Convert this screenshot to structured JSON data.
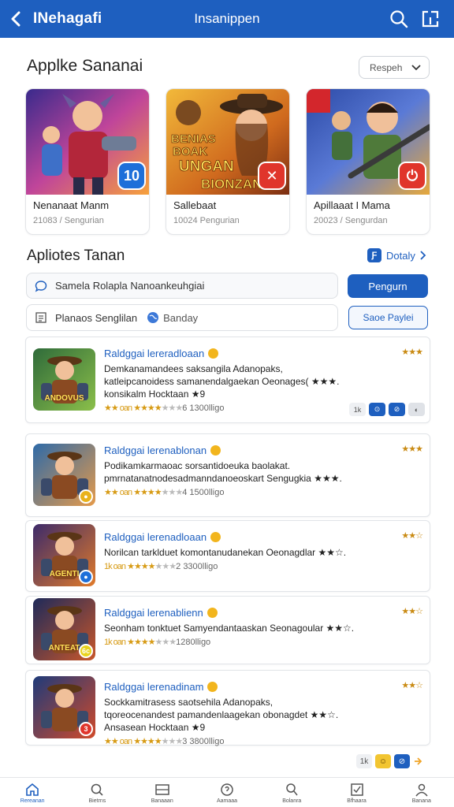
{
  "header": {
    "app_title": "INehagafi",
    "screen_title": "Insanippen",
    "icons": [
      "back-arrow-icon",
      "search-icon",
      "share-icon"
    ]
  },
  "section1": {
    "title": "Applke Sananai",
    "sort_label": "Respeh",
    "cards": [
      {
        "name": "Nenanaat Manm",
        "meta": "21083 / Sengurian",
        "badge": "10",
        "badge_color": "#1e6fd9"
      },
      {
        "name": "Sallebaat",
        "meta": "10024 Pengurian",
        "badge": "✕",
        "badge_color": "#e0352b",
        "art_text": [
          "BENIAS",
          "BOAK",
          "UNGAN",
          "BIONZAN"
        ]
      },
      {
        "name": "Apillaaat I Mama",
        "meta": "20023 / Sengurdan",
        "badge": "⏻",
        "badge_color": "#e0352b"
      }
    ]
  },
  "section2": {
    "title": "Apliotes Tanan",
    "see_all": "Dotaly",
    "see_all_icon": "Ƒ",
    "search_placeholder": "Samela Rolapla  Nanoankeuhgiai",
    "search_button": "Pengurn",
    "filter_label": "Planaos Senglilan",
    "filter_chip": "Banday",
    "filter_button": "Saoe Paylei"
  },
  "apps": [
    {
      "title": "Raldggai lereradloaan",
      "stars": "★★★",
      "desc1": "Demkanamandees saksangila Adanopaks,",
      "desc2": "katleipcanoidess samanendalgaekan Oeonages( ★★★.",
      "desc3": "konsikalm Hocktaan ★9",
      "meta_prefix": "★★ oan",
      "meta_stars": "★★★★",
      "meta_gray": "★★★",
      "meta_suffix": "6 1300lligo",
      "thumb_text": "ANDOVUS",
      "mini": "",
      "mini_color": "#1e6fd9"
    },
    {
      "title": "Raldggai lerenablonan",
      "stars": "★★★",
      "desc1": "Podikamkarmaoac sorsantidoeuka baolakat.",
      "desc2": "pmrnatanatnodesadmanndanoeoskart Sengugkia ★★★.",
      "desc3": "",
      "meta_prefix": "★★ oan",
      "meta_stars": "★★★★",
      "meta_gray": "★★★",
      "meta_suffix": "4 1500lligo",
      "thumb_text": "",
      "mini": "●",
      "mini_color": "#e9b21c"
    },
    {
      "title": "Raldggai lerenadloaan",
      "stars": "★★☆",
      "desc1": "Norilcan tarklduet komontanudanekan Oeonagdlar ★★☆.",
      "desc2": "",
      "desc3": "",
      "meta_prefix": "1k oan",
      "meta_stars": "★★★★",
      "meta_gray": "★★★",
      "meta_suffix": "2 3300lligo",
      "thumb_text": "AGENTI",
      "mini": "●",
      "mini_color": "#1e6fd9"
    },
    {
      "title": "Raldggai lerenablienn",
      "stars": "★★☆",
      "desc1": "Seonham tonktuet Samyendantaaskan Seonagoular ★★☆.",
      "desc2": "",
      "desc3": "",
      "meta_prefix": "1k oan",
      "meta_stars": "★★★★",
      "meta_gray": "★★★",
      "meta_suffix": "1280lligo",
      "thumb_text": "ANTEAT",
      "mini": "6c",
      "mini_color": "#e9d21c"
    },
    {
      "title": "Raldggai lerenadinam",
      "stars": "★★☆",
      "desc1": "Sockkamitrasess saotsehila Adanopaks,",
      "desc2": "tqoreocenandest pamandenlaagekan obonagdet ★★☆.",
      "desc3": "Ansasean Hocktaan ★9",
      "meta_prefix": "★★ oan",
      "meta_stars": "★★★★",
      "meta_gray": "★★★",
      "meta_suffix": "3 3800lligo",
      "thumb_text": "",
      "mini": "3",
      "mini_color": "#e0352b"
    }
  ],
  "list_actions": [
    "1k",
    "⊙",
    "⊘",
    "◐"
  ],
  "page_icons": [
    "1k",
    "☺",
    "⊘"
  ],
  "bottom_nav": [
    {
      "label": "Rereanan",
      "icon": "home-icon"
    },
    {
      "label": "Bietrns",
      "icon": "search-icon"
    },
    {
      "label": "Banaaan",
      "icon": "grid-icon"
    },
    {
      "label": "Aamaaa",
      "icon": "help-icon"
    },
    {
      "label": "Bolanra",
      "icon": "profile-search-icon"
    },
    {
      "label": "Bfhaara",
      "icon": "check-icon"
    },
    {
      "label": "Banana",
      "icon": "person-icon"
    }
  ]
}
